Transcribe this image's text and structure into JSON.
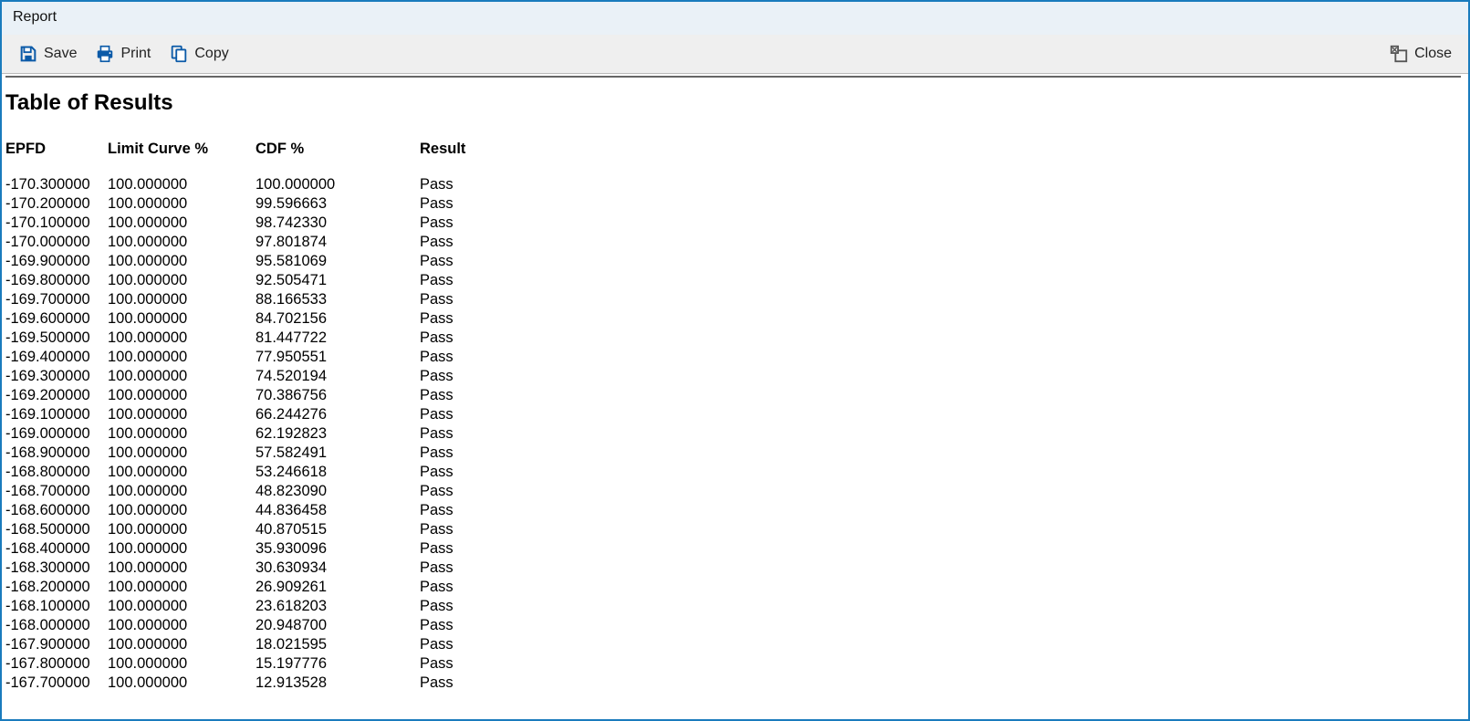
{
  "window": {
    "title": "Report"
  },
  "toolbar": {
    "save_label": "Save",
    "print_label": "Print",
    "copy_label": "Copy",
    "close_label": "Close"
  },
  "report": {
    "title": "Table of Results",
    "columns": {
      "epfd": "EPFD",
      "limit": "Limit Curve %",
      "cdf": "CDF %",
      "result": "Result"
    },
    "rows": [
      {
        "epfd": "-170.300000",
        "limit": "100.000000",
        "cdf": "100.000000",
        "result": "Pass"
      },
      {
        "epfd": "-170.200000",
        "limit": "100.000000",
        "cdf": "99.596663",
        "result": "Pass"
      },
      {
        "epfd": "-170.100000",
        "limit": "100.000000",
        "cdf": "98.742330",
        "result": "Pass"
      },
      {
        "epfd": "-170.000000",
        "limit": "100.000000",
        "cdf": "97.801874",
        "result": "Pass"
      },
      {
        "epfd": "-169.900000",
        "limit": "100.000000",
        "cdf": "95.581069",
        "result": "Pass"
      },
      {
        "epfd": "-169.800000",
        "limit": "100.000000",
        "cdf": "92.505471",
        "result": "Pass"
      },
      {
        "epfd": "-169.700000",
        "limit": "100.000000",
        "cdf": "88.166533",
        "result": "Pass"
      },
      {
        "epfd": "-169.600000",
        "limit": "100.000000",
        "cdf": "84.702156",
        "result": "Pass"
      },
      {
        "epfd": "-169.500000",
        "limit": "100.000000",
        "cdf": "81.447722",
        "result": "Pass"
      },
      {
        "epfd": "-169.400000",
        "limit": "100.000000",
        "cdf": "77.950551",
        "result": "Pass"
      },
      {
        "epfd": "-169.300000",
        "limit": "100.000000",
        "cdf": "74.520194",
        "result": "Pass"
      },
      {
        "epfd": "-169.200000",
        "limit": "100.000000",
        "cdf": "70.386756",
        "result": "Pass"
      },
      {
        "epfd": "-169.100000",
        "limit": "100.000000",
        "cdf": "66.244276",
        "result": "Pass"
      },
      {
        "epfd": "-169.000000",
        "limit": "100.000000",
        "cdf": "62.192823",
        "result": "Pass"
      },
      {
        "epfd": "-168.900000",
        "limit": "100.000000",
        "cdf": "57.582491",
        "result": "Pass"
      },
      {
        "epfd": "-168.800000",
        "limit": "100.000000",
        "cdf": "53.246618",
        "result": "Pass"
      },
      {
        "epfd": "-168.700000",
        "limit": "100.000000",
        "cdf": "48.823090",
        "result": "Pass"
      },
      {
        "epfd": "-168.600000",
        "limit": "100.000000",
        "cdf": "44.836458",
        "result": "Pass"
      },
      {
        "epfd": "-168.500000",
        "limit": "100.000000",
        "cdf": "40.870515",
        "result": "Pass"
      },
      {
        "epfd": "-168.400000",
        "limit": "100.000000",
        "cdf": "35.930096",
        "result": "Pass"
      },
      {
        "epfd": "-168.300000",
        "limit": "100.000000",
        "cdf": "30.630934",
        "result": "Pass"
      },
      {
        "epfd": "-168.200000",
        "limit": "100.000000",
        "cdf": "26.909261",
        "result": "Pass"
      },
      {
        "epfd": "-168.100000",
        "limit": "100.000000",
        "cdf": "23.618203",
        "result": "Pass"
      },
      {
        "epfd": "-168.000000",
        "limit": "100.000000",
        "cdf": "20.948700",
        "result": "Pass"
      },
      {
        "epfd": "-167.900000",
        "limit": "100.000000",
        "cdf": "18.021595",
        "result": "Pass"
      },
      {
        "epfd": "-167.800000",
        "limit": "100.000000",
        "cdf": "15.197776",
        "result": "Pass"
      },
      {
        "epfd": "-167.700000",
        "limit": "100.000000",
        "cdf": "12.913528",
        "result": "Pass"
      }
    ]
  }
}
